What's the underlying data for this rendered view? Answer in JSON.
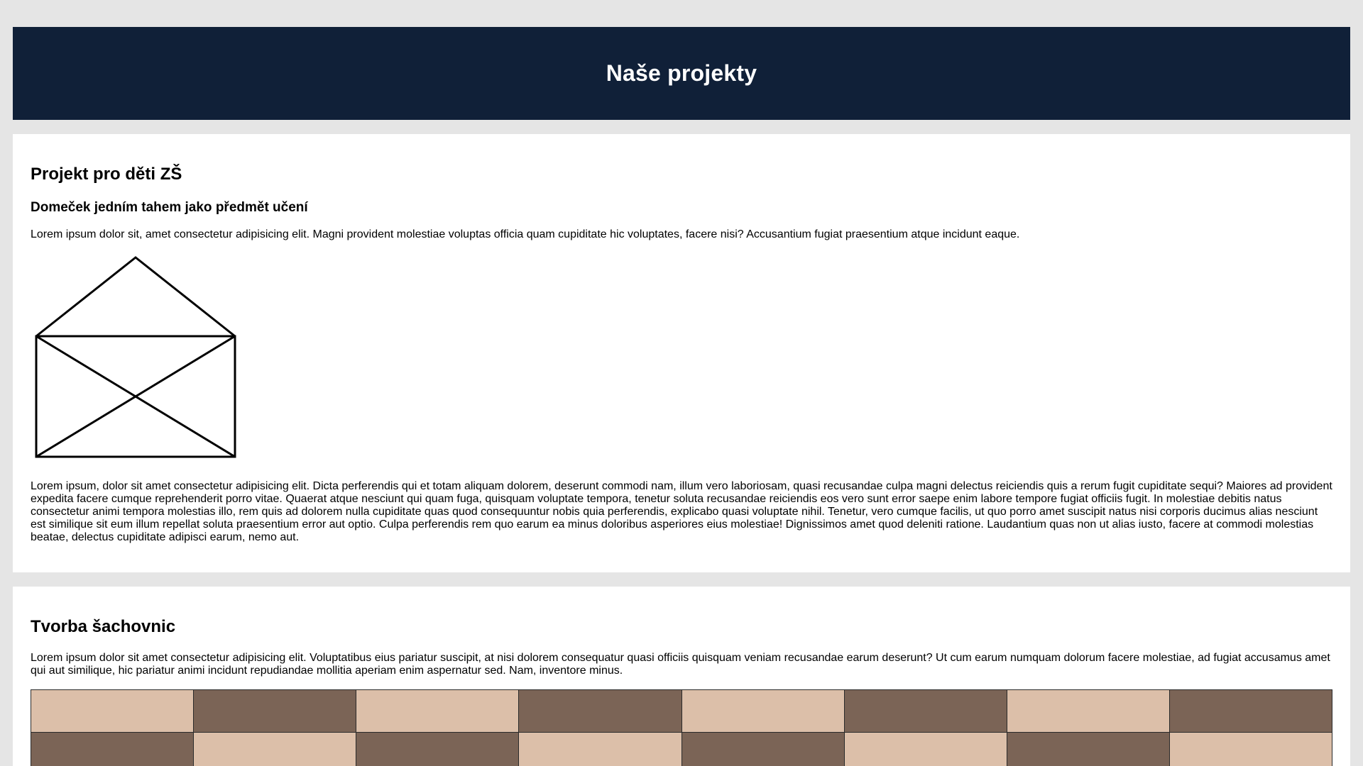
{
  "header": {
    "title": "Naše projekty"
  },
  "project1": {
    "title": "Projekt pro děti ZŠ",
    "subtitle": "Domeček jedním tahem jako předmět učení",
    "intro": "Lorem ipsum dolor sit, amet consectetur adipisicing elit. Magni provident molestiae voluptas officia quam cupiditate hic voluptates, facere nisi? Accusantium fugiat praesentium atque incidunt eaque.",
    "body": "Lorem ipsum, dolor sit amet consectetur adipisicing elit. Dicta perferendis qui et totam aliquam dolorem, deserunt commodi nam, illum vero laboriosam, quasi recusandae culpa magni delectus reiciendis quis a rerum fugit cupiditate sequi? Maiores ad provident expedita facere cumque reprehenderit porro vitae. Quaerat atque nesciunt qui quam fuga, quisquam voluptate tempora, tenetur soluta recusandae reiciendis eos vero sunt error saepe enim labore tempore fugiat officiis fugit. In molestiae debitis natus consectetur animi tempora molestias illo, rem quis ad dolorem nulla cupiditate quas quod consequuntur nobis quia perferendis, explicabo quasi voluptate nihil. Tenetur, vero cumque facilis, ut quo porro amet suscipit natus nisi corporis ducimus alias nesciunt est similique sit eum illum repellat soluta praesentium error aut optio. Culpa perferendis rem quo earum ea minus doloribus asperiores eius molestiae! Dignissimos amet quod deleniti ratione. Laudantium quas non ut alias iusto, facere at commodi molestias beatae, delectus cupiditate adipisci earum, nemo aut."
  },
  "project2": {
    "title": "Tvorba šachovnic",
    "intro": "Lorem ipsum dolor sit amet consectetur adipisicing elit. Voluptatibus eius pariatur suscipit, at nisi dolorem consequatur quasi officiis quisquam veniam recusandae earum deserunt? Ut cum earum numquam dolorum facere molestiae, ad fugiat accusamus amet qui aut similique, hic pariatur animi incidunt repudiandae mollitia aperiam enim aspernatur sed. Nam, inventore minus."
  },
  "chessboard": {
    "light_color": "#dcbfa9",
    "dark_color": "#7b6456",
    "columns": 8,
    "visible_rows": 2
  }
}
